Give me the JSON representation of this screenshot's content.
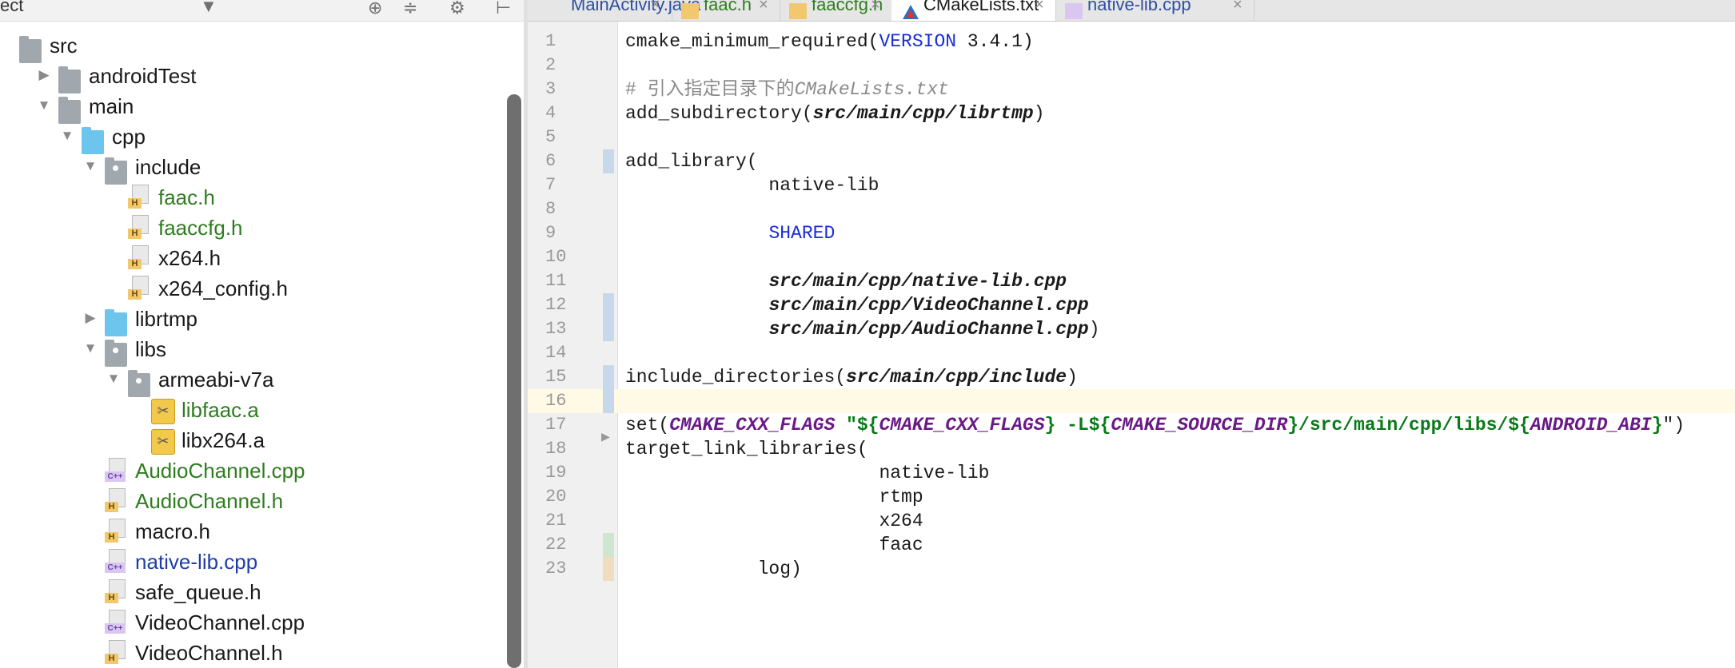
{
  "project_panel": {
    "title": "ect",
    "header_icons": [
      "target-icon",
      "collapse-icon",
      "gear-icon",
      "hide-icon"
    ],
    "tree": [
      {
        "label": "src",
        "icon": "folder",
        "color": "normal",
        "depth": 0,
        "arrow": "none"
      },
      {
        "label": "androidTest",
        "icon": "folder",
        "color": "normal",
        "depth": 1,
        "arrow": "right"
      },
      {
        "label": "main",
        "icon": "folder",
        "color": "normal",
        "depth": 1,
        "arrow": "down"
      },
      {
        "label": "cpp",
        "icon": "folder-cyan",
        "color": "normal",
        "depth": 2,
        "arrow": "down"
      },
      {
        "label": "include",
        "icon": "package",
        "color": "normal",
        "depth": 3,
        "arrow": "down"
      },
      {
        "label": "faac.h",
        "icon": "h-file",
        "color": "green",
        "depth": 4,
        "arrow": "none"
      },
      {
        "label": "faaccfg.h",
        "icon": "h-file",
        "color": "green",
        "depth": 4,
        "arrow": "none"
      },
      {
        "label": "x264.h",
        "icon": "h-file",
        "color": "normal",
        "depth": 4,
        "arrow": "none"
      },
      {
        "label": "x264_config.h",
        "icon": "h-file",
        "color": "normal",
        "depth": 4,
        "arrow": "none"
      },
      {
        "label": "librtmp",
        "icon": "folder-cyan",
        "color": "normal",
        "depth": 3,
        "arrow": "right"
      },
      {
        "label": "libs",
        "icon": "package",
        "color": "normal",
        "depth": 3,
        "arrow": "down"
      },
      {
        "label": "armeabi-v7a",
        "icon": "package",
        "color": "normal",
        "depth": 4,
        "arrow": "down"
      },
      {
        "label": "libfaac.a",
        "icon": "archive",
        "color": "green",
        "depth": 5,
        "arrow": "none"
      },
      {
        "label": "libx264.a",
        "icon": "archive",
        "color": "normal",
        "depth": 5,
        "arrow": "none"
      },
      {
        "label": "AudioChannel.cpp",
        "icon": "cpp-file",
        "color": "green",
        "depth": 3,
        "arrow": "none"
      },
      {
        "label": "AudioChannel.h",
        "icon": "h-file",
        "color": "green",
        "depth": 3,
        "arrow": "none"
      },
      {
        "label": "macro.h",
        "icon": "h-file",
        "color": "normal",
        "depth": 3,
        "arrow": "none"
      },
      {
        "label": "native-lib.cpp",
        "icon": "cpp-file",
        "color": "blue",
        "depth": 3,
        "arrow": "none"
      },
      {
        "label": "safe_queue.h",
        "icon": "h-file",
        "color": "normal",
        "depth": 3,
        "arrow": "none"
      },
      {
        "label": "VideoChannel.cpp",
        "icon": "cpp-file",
        "color": "normal",
        "depth": 3,
        "arrow": "none"
      },
      {
        "label": "VideoChannel.h",
        "icon": "h-file",
        "color": "normal",
        "depth": 3,
        "arrow": "none"
      }
    ]
  },
  "tabs": [
    {
      "label": "MainActivity.java",
      "icon": "java",
      "active": false,
      "color": "blue"
    },
    {
      "label": "faac.h",
      "icon": "h",
      "active": false,
      "color": "green"
    },
    {
      "label": "faaccfg.h",
      "icon": "h",
      "active": false,
      "color": "green"
    },
    {
      "label": "CMakeLists.txt",
      "icon": "cmake",
      "active": true,
      "color": "normal"
    },
    {
      "label": "native-lib.cpp",
      "icon": "cpp",
      "active": false,
      "color": "blue"
    }
  ],
  "tab_close_glyph": "×",
  "editor": {
    "current_line": 16,
    "lines": [
      {
        "n": "1",
        "mark": "",
        "code": [
          {
            "t": "cmake_minimum_required("
          },
          {
            "t": "VERSION",
            "c": "kw"
          },
          {
            "t": " 3.4.1)"
          }
        ]
      },
      {
        "n": "2",
        "mark": "",
        "code": []
      },
      {
        "n": "3",
        "mark": "",
        "code": [
          {
            "t": "# 引入指定目录下的",
            "c": "cm"
          },
          {
            "t": "CMakeLists.txt",
            "c": "cm-it"
          }
        ]
      },
      {
        "n": "4",
        "mark": "",
        "code": [
          {
            "t": "add_subdirectory("
          },
          {
            "t": "src/main/cpp/librtmp",
            "c": "it"
          },
          {
            "t": ")"
          }
        ]
      },
      {
        "n": "5",
        "mark": "",
        "code": []
      },
      {
        "n": "6",
        "mark": "blue",
        "code": [
          {
            "t": "add_library("
          }
        ]
      },
      {
        "n": "7",
        "mark": "",
        "code": [
          {
            "t": "             native-lib"
          }
        ]
      },
      {
        "n": "8",
        "mark": "",
        "code": []
      },
      {
        "n": "9",
        "mark": "",
        "code": [
          {
            "t": "             "
          },
          {
            "t": "SHARED",
            "c": "kw"
          }
        ]
      },
      {
        "n": "10",
        "mark": "",
        "code": []
      },
      {
        "n": "11",
        "mark": "",
        "code": [
          {
            "t": "             "
          },
          {
            "t": "src/main/cpp/native-lib.cpp",
            "c": "it"
          }
        ]
      },
      {
        "n": "12",
        "mark": "blue",
        "code": [
          {
            "t": "             "
          },
          {
            "t": "src/main/cpp/VideoChannel.cpp",
            "c": "it"
          }
        ]
      },
      {
        "n": "13",
        "mark": "blue",
        "code": [
          {
            "t": "             "
          },
          {
            "t": "src/main/cpp/AudioChannel.cpp",
            "c": "it"
          },
          {
            "t": ")"
          }
        ]
      },
      {
        "n": "14",
        "mark": "",
        "code": []
      },
      {
        "n": "15",
        "mark": "blue",
        "code": [
          {
            "t": "include_directories("
          },
          {
            "t": "src/main/cpp/include",
            "c": "it"
          },
          {
            "t": ")"
          }
        ]
      },
      {
        "n": "16",
        "mark": "blue",
        "code": []
      },
      {
        "n": "17",
        "mark": "",
        "code": [
          {
            "t": "set("
          },
          {
            "t": "CMAKE_CXX_FLAGS",
            "c": "pv"
          },
          {
            "t": " \"",
            "c": "str"
          },
          {
            "t": "${",
            "c": "str"
          },
          {
            "t": "CMAKE_CXX_FLAGS",
            "c": "pv"
          },
          {
            "t": "}",
            "c": "str"
          },
          {
            "t": " -L$",
            "c": "str"
          },
          {
            "t": "{",
            "c": "str"
          },
          {
            "t": "CMAKE_SOURCE_DIR",
            "c": "pv"
          },
          {
            "t": "}/src/main/cpp/libs/${",
            "c": "str"
          },
          {
            "t": "ANDROID_ABI",
            "c": "pv"
          },
          {
            "t": "}",
            "c": "str"
          },
          {
            "t": "\")"
          }
        ]
      },
      {
        "n": "18",
        "mark": "",
        "code": [
          {
            "t": "target_link_libraries("
          }
        ]
      },
      {
        "n": "19",
        "mark": "",
        "code": [
          {
            "t": "                       native-lib"
          }
        ]
      },
      {
        "n": "20",
        "mark": "",
        "code": [
          {
            "t": "                       rtmp"
          }
        ]
      },
      {
        "n": "21",
        "mark": "",
        "code": [
          {
            "t": "                       x264"
          }
        ]
      },
      {
        "n": "22",
        "mark": "green",
        "code": [
          {
            "t": "                       faac"
          }
        ]
      },
      {
        "n": "23",
        "mark": "tan",
        "code": [
          {
            "t": "            log)"
          }
        ]
      }
    ]
  },
  "colors": {
    "keyword": "#1a2dd6",
    "variable": "#6a1a87",
    "string": "#0a7a18",
    "comment": "#8a8a8a",
    "vcs_new": "#2e7d1f",
    "vcs_modified": "#1f3fa8",
    "current_line": "#fffae6"
  }
}
